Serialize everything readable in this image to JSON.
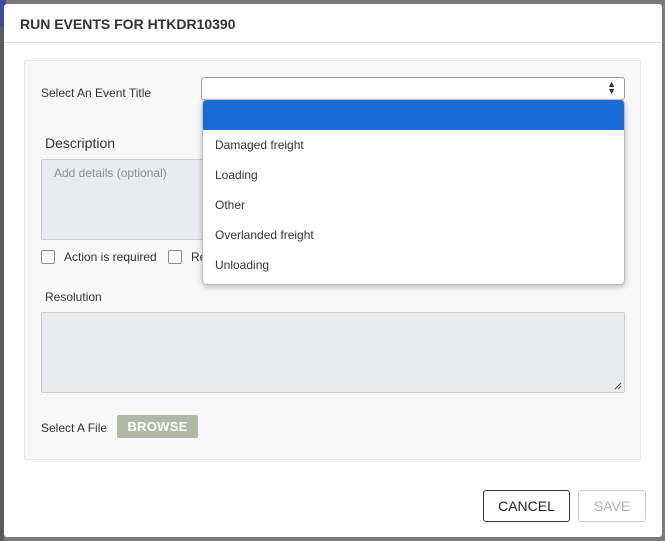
{
  "modal": {
    "title": "RUN EVENTS FOR HTKDR10390"
  },
  "form": {
    "event_title_label": "Select An Event Title",
    "event_title_value": "",
    "description_label": "Description",
    "description_placeholder": "Add details (optional)",
    "checkboxes": [
      {
        "label": "Action is required",
        "checked": false
      },
      {
        "label": "Re",
        "checked": false
      }
    ],
    "resolution_label": "Resolution",
    "file_label": "Select A File",
    "browse_label": "BROWSE"
  },
  "dropdown": {
    "options": [
      {
        "label": "",
        "selected": true
      },
      {
        "label": "Damaged freight",
        "selected": false
      },
      {
        "label": "Loading",
        "selected": false
      },
      {
        "label": "Other",
        "selected": false
      },
      {
        "label": "Overlanded freight",
        "selected": false
      },
      {
        "label": "Unloading",
        "selected": false
      }
    ]
  },
  "footer": {
    "cancel_label": "CANCEL",
    "save_label": "SAVE"
  },
  "colors": {
    "selected_option": "#1a6bd6",
    "browse_button": "#b1b8a6"
  }
}
